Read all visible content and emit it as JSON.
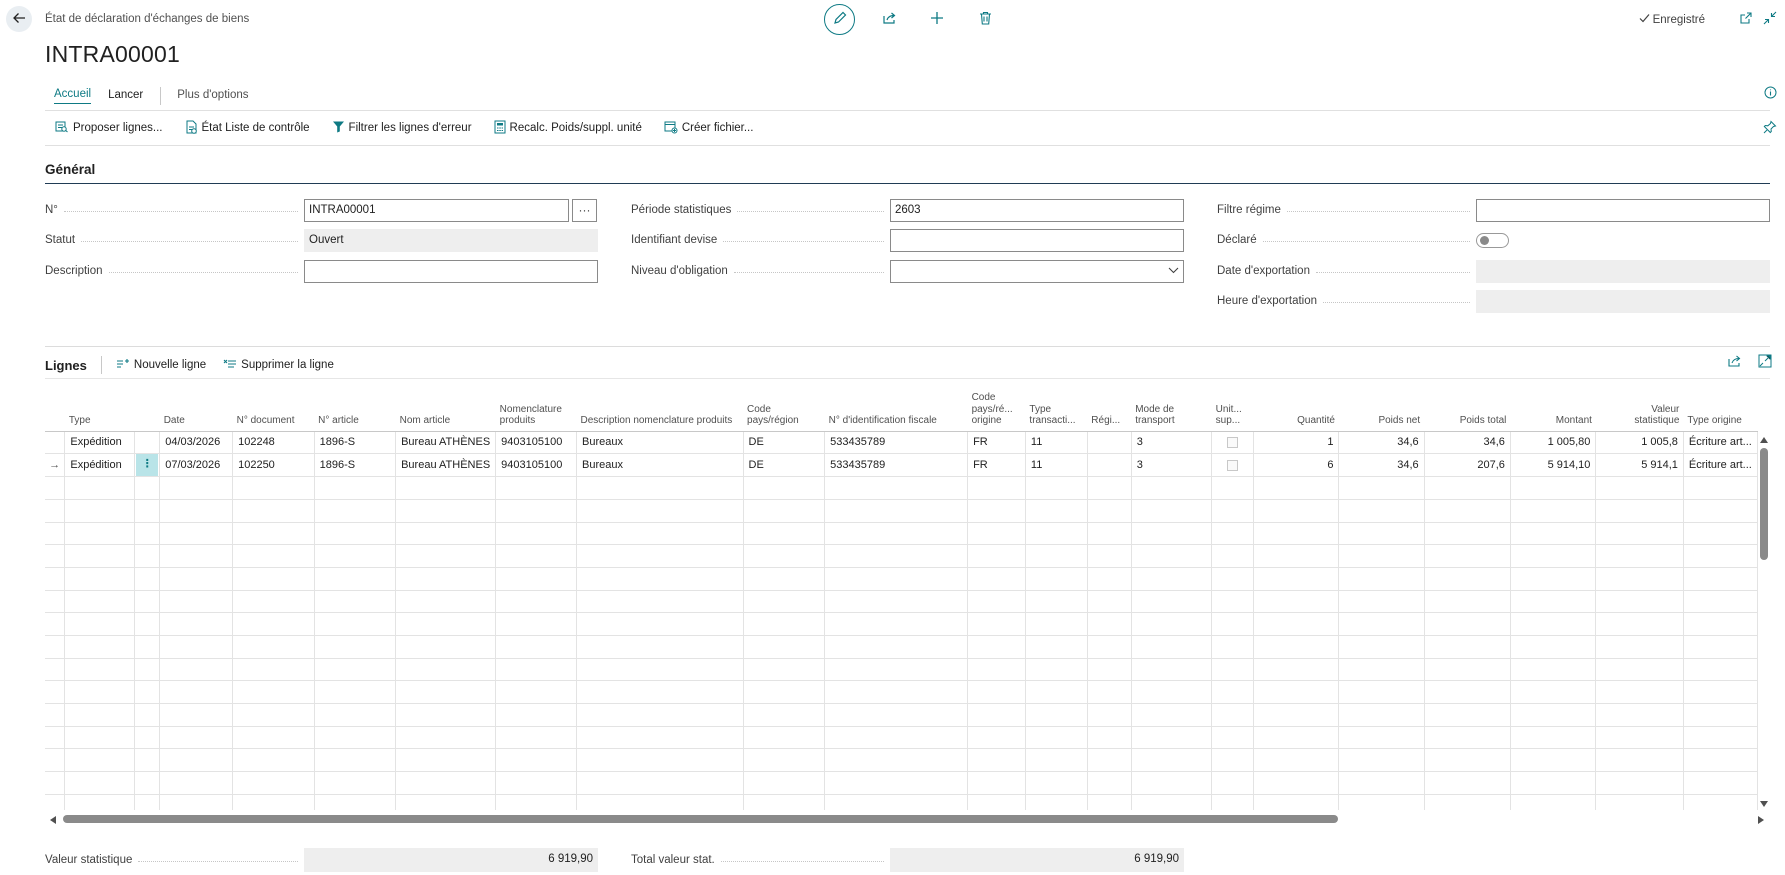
{
  "header": {
    "caption": "État de déclaration d'échanges de biens",
    "title": "INTRA00001",
    "saved_label": "Enregistré",
    "icons": [
      "back-arrow-icon",
      "pencil-icon",
      "share-icon",
      "plus-icon",
      "trash-icon",
      "open-new-window-icon",
      "collapse-icon"
    ]
  },
  "tabs": {
    "accueil": "Accueil",
    "lancer": "Lancer",
    "more": "Plus d'options"
  },
  "actions": {
    "propose": "Proposer lignes...",
    "checklist": "État Liste de contrôle",
    "filter_errors": "Filtrer les lignes d'erreur",
    "recalc": "Recalc. Poids/suppl. unité",
    "create_file": "Créer fichier..."
  },
  "general": {
    "title": "Général",
    "no_label": "N°",
    "no_value": "INTRA00001",
    "status_label": "Statut",
    "status_value": "Ouvert",
    "description_label": "Description",
    "description_value": "",
    "period_label": "Période statistiques",
    "period_value": "2603",
    "currency_label": "Identifiant devise",
    "currency_value": "",
    "obligation_label": "Niveau d'obligation",
    "obligation_value": "",
    "regime_filter_label": "Filtre régime",
    "regime_filter_value": "",
    "declared_label": "Déclaré",
    "declared_value": false,
    "export_date_label": "Date d'exportation",
    "export_time_label": "Heure d'exportation"
  },
  "lines": {
    "title": "Lignes",
    "new_line": "Nouvelle ligne",
    "delete_line": "Supprimer la ligne",
    "columns": {
      "type": "Type",
      "date": "Date",
      "doc_no": "N° document",
      "item_no": "N° article",
      "item_name": "Nom article",
      "tariff_1": "Nomenclature",
      "tariff_2": "produits",
      "tariff_desc": "Description nomenclature produits",
      "country_1": "Code",
      "country_2": "pays/région",
      "vat_id": "N° d'identification fiscale",
      "origin_1": "Code",
      "origin_2": "pays/ré...",
      "origin_3": "origine",
      "trans_1": "Type",
      "trans_2": "transacti...",
      "regime": "Régi...",
      "transport_1": "Mode de",
      "transport_2": "transport",
      "supp_1": "Unit...",
      "supp_2": "sup...",
      "quantity": "Quantité",
      "net_weight": "Poids net",
      "total_weight": "Poids total",
      "amount": "Montant",
      "stat_1": "Valeur",
      "stat_2": "statistique",
      "source_type": "Type origine"
    },
    "rows": [
      {
        "type": "Expédition",
        "date": "04/03/2026",
        "doc_no": "102248",
        "item_no": "1896-S",
        "item_name": "Bureau ATHÈNES",
        "tariff": "9403105100",
        "tariff_desc": "Bureaux",
        "country": "DE",
        "vat_id": "533435789",
        "origin": "FR",
        "trans_type": "11",
        "regime": "",
        "transport": "3",
        "quantity": "1",
        "net_weight": "34,6",
        "total_weight": "34,6",
        "amount": "1 005,80",
        "stat_value": "1 005,8",
        "source_type": "Écriture art..."
      },
      {
        "type": "Expédition",
        "date": "07/03/2026",
        "doc_no": "102250",
        "item_no": "1896-S",
        "item_name": "Bureau ATHÈNES",
        "tariff": "9403105100",
        "tariff_desc": "Bureaux",
        "country": "DE",
        "vat_id": "533435789",
        "origin": "FR",
        "trans_type": "11",
        "regime": "",
        "transport": "3",
        "quantity": "6",
        "net_weight": "34,6",
        "total_weight": "207,6",
        "amount": "5 914,10",
        "stat_value": "5 914,1",
        "source_type": "Écriture art..."
      }
    ]
  },
  "totals": {
    "stat_label": "Valeur statistique",
    "stat_value": "6 919,90",
    "total_label": "Total valeur stat.",
    "total_value": "6 919,90"
  }
}
